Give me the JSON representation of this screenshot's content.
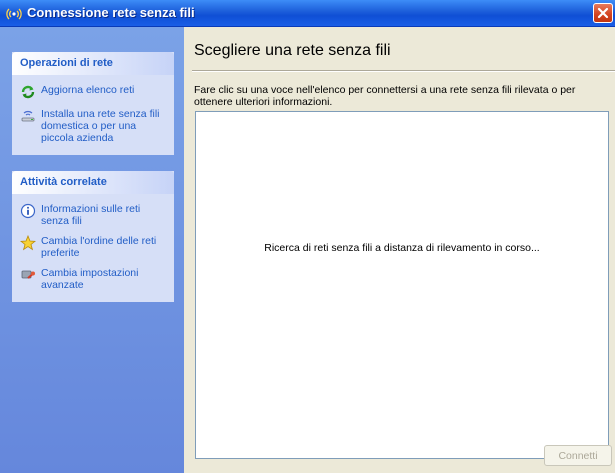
{
  "window": {
    "title": "Connessione rete senza fili",
    "title_icon": "wireless-signal-icon",
    "close_icon": "close-icon"
  },
  "task_pane": {
    "network_tasks": {
      "header": "Operazioni di rete",
      "items": [
        {
          "label": "Aggiorna elenco reti",
          "icon": "refresh-icon"
        },
        {
          "label": "Installa una rete senza fili domestica o per una piccola azienda",
          "icon": "setup-wizard-icon"
        }
      ]
    },
    "related_tasks": {
      "header": "Attività correlate",
      "items": [
        {
          "label": "Informazioni sulle reti senza fili",
          "icon": "info-icon"
        },
        {
          "label": "Cambia l'ordine delle reti preferite",
          "icon": "star-icon"
        },
        {
          "label": "Cambia impostazioni avanzate",
          "icon": "settings-icon"
        }
      ]
    }
  },
  "main": {
    "heading": "Scegliere una rete senza fili",
    "description": "Fare clic su una voce nell'elenco per connettersi a una rete senza fili rilevata o per ottenere ulteriori informazioni.",
    "status": "Ricerca di reti senza fili a distanza di rilevamento in corso...",
    "connect_button": "Connetti",
    "connect_enabled": false
  },
  "colors": {
    "titlebar": "#1f62dc",
    "taskpane": "#6f93e0",
    "link": "#215dc6",
    "close": "#d3421f"
  }
}
